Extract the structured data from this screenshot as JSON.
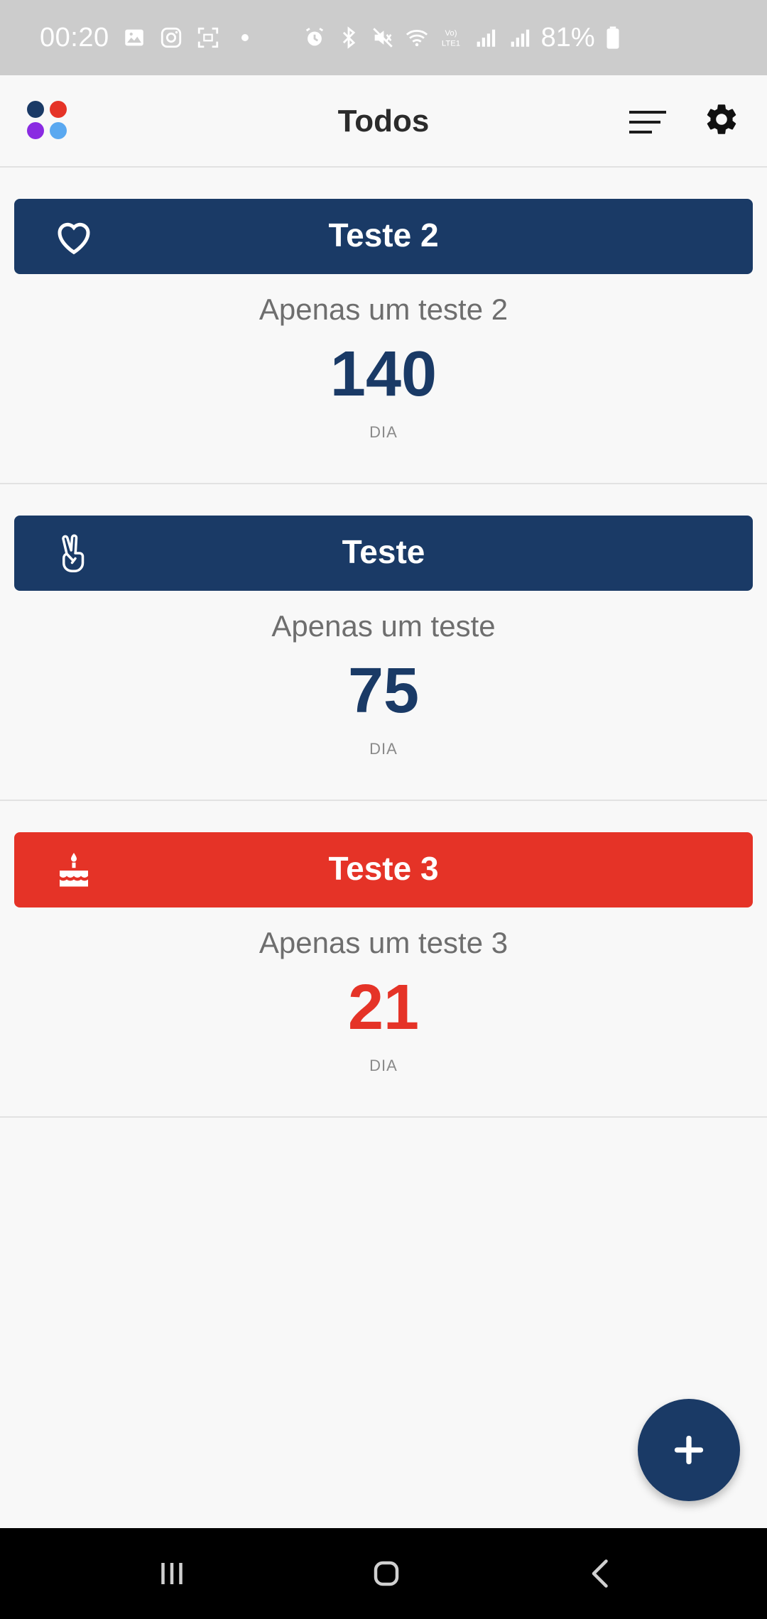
{
  "status_bar": {
    "time": "00:20",
    "battery": "81%",
    "icons": [
      "image-icon",
      "instagram-icon",
      "screenshot-icon",
      "dot-icon",
      "alarm-icon",
      "bluetooth-icon",
      "mute-icon",
      "wifi-icon",
      "volte-icon",
      "signal-icon",
      "signal-icon",
      "battery-icon"
    ]
  },
  "app_bar": {
    "title": "Todos",
    "logo_colors": [
      "#1a3a66",
      "#e53327",
      "#8a2be2",
      "#5aa8f0"
    ]
  },
  "cards": [
    {
      "title": "Teste 2",
      "description": "Apenas um teste 2",
      "count": "140",
      "unit": "DIA",
      "color": "#1a3a66",
      "icon": "heart-icon"
    },
    {
      "title": "Teste",
      "description": "Apenas um teste",
      "count": "75",
      "unit": "DIA",
      "color": "#1a3a66",
      "icon": "peace-hand-icon"
    },
    {
      "title": "Teste 3",
      "description": "Apenas um teste 3",
      "count": "21",
      "unit": "DIA",
      "color": "#e53327",
      "icon": "birthday-cake-icon"
    }
  ],
  "fab": {
    "icon": "plus-icon",
    "color": "#1a3a66"
  },
  "nav_bar": {
    "buttons": [
      "recents-icon",
      "home-icon",
      "back-icon"
    ]
  }
}
